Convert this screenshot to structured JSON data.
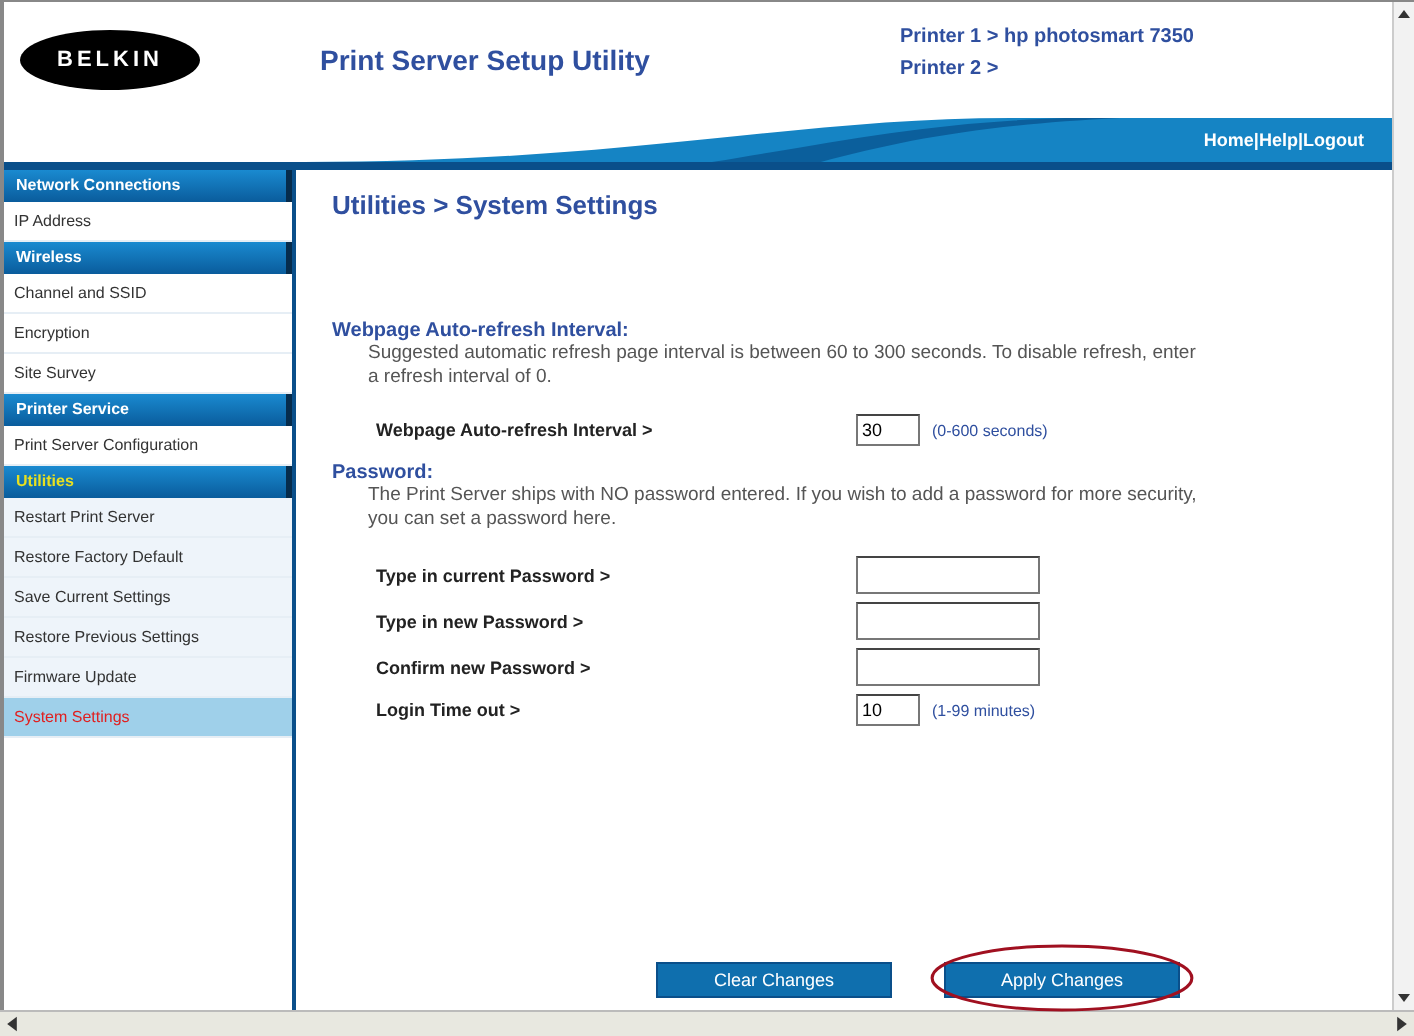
{
  "header": {
    "logo": "BELKIN",
    "title": "Print Server Setup Utility",
    "printers": [
      "Printer 1 > hp photosmart 7350",
      "Printer 2 >"
    ],
    "nav": {
      "links": [
        "Home",
        "Help",
        "Logout"
      ],
      "separator": "|"
    }
  },
  "sidebar": {
    "sections": [
      {
        "title": "Network Connections",
        "active": false,
        "items": [
          {
            "label": "IP Address",
            "selected": false
          }
        ]
      },
      {
        "title": "Wireless",
        "active": false,
        "items": [
          {
            "label": "Channel and SSID",
            "selected": false
          },
          {
            "label": "Encryption",
            "selected": false
          },
          {
            "label": "Site Survey",
            "selected": false
          }
        ]
      },
      {
        "title": "Printer Service",
        "active": false,
        "items": [
          {
            "label": "Print Server Configuration",
            "selected": false
          }
        ]
      },
      {
        "title": "Utilities",
        "active": true,
        "items": [
          {
            "label": "Restart Print Server",
            "selected": false
          },
          {
            "label": "Restore Factory Default",
            "selected": false
          },
          {
            "label": "Save Current Settings",
            "selected": false
          },
          {
            "label": "Restore Previous Settings",
            "selected": false
          },
          {
            "label": "Firmware Update",
            "selected": false
          },
          {
            "label": "System Settings",
            "selected": true
          }
        ]
      }
    ]
  },
  "main": {
    "breadcrumb": "Utilities > System Settings",
    "sections": [
      {
        "heading": "Webpage Auto-refresh Interval:",
        "description": "Suggested automatic refresh page interval is between 60 to 300 seconds. To disable refresh, enter a refresh interval of 0.",
        "fields": [
          {
            "kind": "short",
            "label": "Webpage Auto-refresh Interval >",
            "value": "30",
            "hint": "(0-600 seconds)"
          }
        ]
      },
      {
        "heading": "Password:",
        "description": "The Print Server ships with NO password entered. If you wish to add a password for more security, you can set a password here.",
        "fields": [
          {
            "kind": "long",
            "label": "Type in current Password >"
          },
          {
            "kind": "long",
            "label": "Type in new Password >"
          },
          {
            "kind": "long",
            "label": "Confirm new Password >"
          },
          {
            "kind": "short",
            "label": "Login Time out >",
            "value": "10",
            "hint": "(1-99 minutes)"
          }
        ]
      }
    ],
    "buttons": [
      {
        "label": "Clear Changes",
        "circled": false
      },
      {
        "label": "Apply Changes",
        "circled": true
      }
    ]
  }
}
